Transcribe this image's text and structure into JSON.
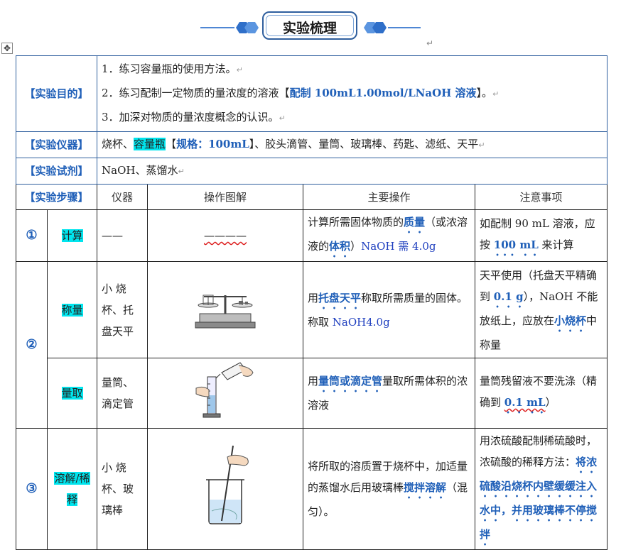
{
  "banner": {
    "title": "实验梳理"
  },
  "purpose": {
    "label": "【实验目的】",
    "item1": "1．练习容量瓶的使用方法。",
    "item2_pre": "2．练习配制一定物质的量浓度的溶液【",
    "item2_hl": "配制 100mL1.00mol/LNaOH 溶液",
    "item2_post": "】。",
    "item3": "3．加深对物质的量浓度概念的认识。"
  },
  "instruments": {
    "label": "【实验仪器】",
    "pre": "烧杯、",
    "hl": "容量瓶",
    "bracket_open": "【",
    "spec": "规格：100mL",
    "post": "】、胶头滴管、量筒、玻璃棒、药匙、滤纸、天平"
  },
  "reagents": {
    "label": "【实验试剂】",
    "text": "NaOH、蒸馏水"
  },
  "steps": {
    "label": "【实验步骤】",
    "headers": [
      "仪器",
      "操作图解",
      "主要操作",
      "注意事项"
    ],
    "rows": [
      {
        "num": "①",
        "name": "计算",
        "instrument": "——",
        "diagram": "————",
        "op_pre": "计算所需固体物质的",
        "op_k1": "质量",
        "op_mid": "（或浓溶液的",
        "op_k2": "体积",
        "op_post": "）",
        "op_blue": "NaOH 需 4.0g",
        "note_pre": "如配制 90 mL 溶液，应按 ",
        "note_k": "100 mL",
        "note_post": " 来计算"
      },
      {
        "num": "②",
        "name": "称量",
        "instrument": "小 烧杯、托盘天平",
        "op_pre": "用",
        "op_k1": "托盘天平",
        "op_mid": "称取所需质量的固体。称取 ",
        "op_blue": "NaOH4.0g",
        "note_pre": "天平使用（托盘天平精确到 ",
        "note_k": "0.1 g",
        "note_mid": "），NaOH 不能放纸上，应放在",
        "note_k2": "小烧杯",
        "note_post": "中称量"
      },
      {
        "name": "量取",
        "instrument": "量筒、滴定管",
        "op_pre": "用",
        "op_k1": "量筒或滴定管",
        "op_post": "量取所需体积的浓溶液",
        "note_pre": "量筒残留液不要洗涤（精确到 ",
        "note_k": "0.1 mL",
        "note_post": "）"
      },
      {
        "num": "③",
        "name": "溶解/稀释",
        "instrument": "小 烧杯、玻璃棒",
        "op_pre": "将所取的溶质置于烧杯中，加适量的蒸馏水后用玻璃棒",
        "op_k1": "搅拌溶解",
        "op_post": "（混匀）。",
        "note_pre": "用浓硫酸配制稀硫酸时，浓硫酸的稀释方法：",
        "note_k": "将浓硫酸沿烧杯内壁缓缓注入水中，并用玻璃棒不停搅拌"
      }
    ]
  },
  "icons": [
    "move-handle-icon",
    "balance-icon",
    "cylinder-pouring-icon",
    "beaker-stirring-icon",
    "paragraph-mark-icon"
  ]
}
